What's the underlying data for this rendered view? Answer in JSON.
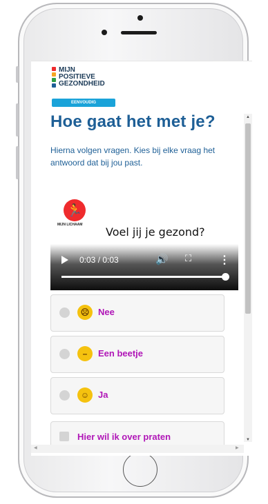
{
  "brand": {
    "logo_lines": "MIJN\nPOSITIEVE\nGEZONDHEID",
    "badge": "EENVOUDIG",
    "colors": [
      "#ef2b2d",
      "#f5a623",
      "#2f9e44",
      "#1e5f96"
    ]
  },
  "page": {
    "title": "Hoe gaat het met je?",
    "intro": "Hierna volgen vragen. Kies bij elke vraag het antwoord dat bij jou past."
  },
  "category": {
    "icon": "running-person-icon",
    "label": "MIJN LICHAAM"
  },
  "question": "Voel jij je gezond?",
  "video": {
    "time": "0:03 / 0:03",
    "progress": 1.0
  },
  "options": [
    {
      "label": "Nee",
      "emoji": "sad-face-icon",
      "glyph": "☹"
    },
    {
      "label": "Een beetje",
      "emoji": "neutral-face-icon",
      "glyph": "😐"
    },
    {
      "label": "Ja",
      "emoji": "happy-face-icon",
      "glyph": "☺"
    }
  ],
  "talk_option": {
    "label": "Hier wil ik over praten"
  }
}
